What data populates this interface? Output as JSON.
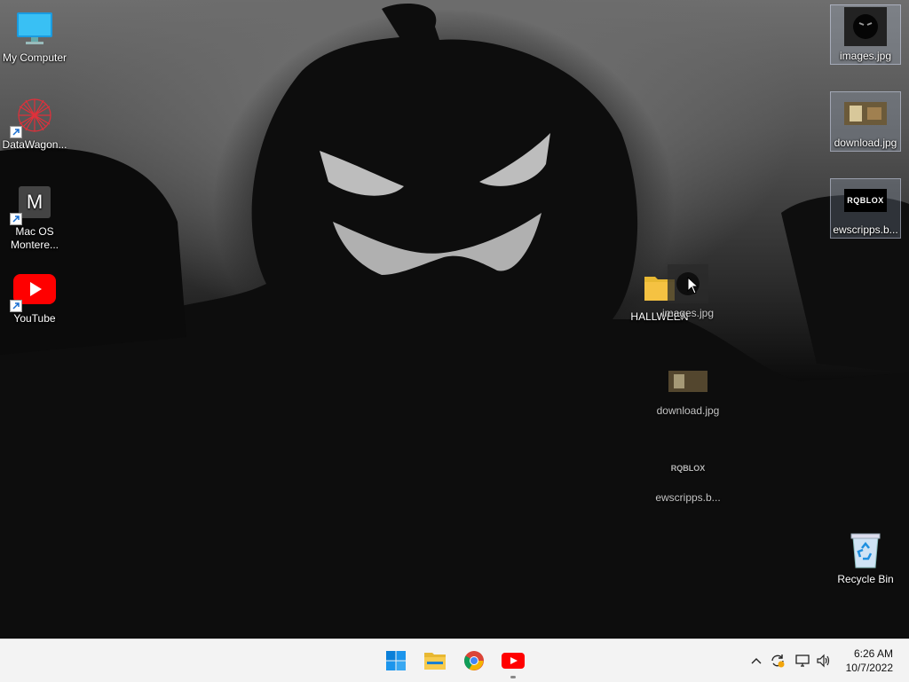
{
  "desktop": {
    "left_icons": [
      {
        "label": "My Computer",
        "icon": "monitor-icon"
      },
      {
        "label": "DataWagon...",
        "icon": "datawagon-icon"
      },
      {
        "label": "Mac OS Montere...",
        "icon": "mac-os-icon",
        "letter": "M"
      },
      {
        "label": "YouTube",
        "icon": "youtube-icon"
      }
    ],
    "right_icons": [
      {
        "label": "images.jpg",
        "icon": "pumpkin-thumbnail-icon"
      },
      {
        "label": "download.jpg",
        "icon": "photo-thumbnail-icon"
      },
      {
        "label": "ewscripps.b...",
        "icon": "roblox-thumbnail-icon",
        "logo_text": "RQBLOX"
      },
      {
        "label": "Recycle Bin",
        "icon": "recycle-bin-icon"
      }
    ],
    "middle_icons": [
      {
        "label": "HALLWEEN",
        "icon": "folder-icon"
      },
      {
        "label": "images.jpg",
        "icon": "pumpkin-thumbnail-icon"
      },
      {
        "label": "download.jpg",
        "icon": "photo-thumbnail-icon"
      },
      {
        "label": "ewscripps.b...",
        "icon": "roblox-thumbnail-icon",
        "logo_text": "RQBLOX"
      }
    ]
  },
  "taskbar": {
    "apps": [
      "start-icon",
      "file-explorer-icon",
      "chrome-icon",
      "youtube-icon"
    ],
    "tray": [
      "chevron-up-icon",
      "update-icon",
      "network-icon",
      "volume-icon"
    ],
    "clock": {
      "time": "6:26 AM",
      "date": "10/7/2022"
    }
  },
  "colors": {
    "taskbar_bg": "#f3f3f3",
    "youtube_red": "#ff0000",
    "folder_yellow": "#f5c242"
  }
}
